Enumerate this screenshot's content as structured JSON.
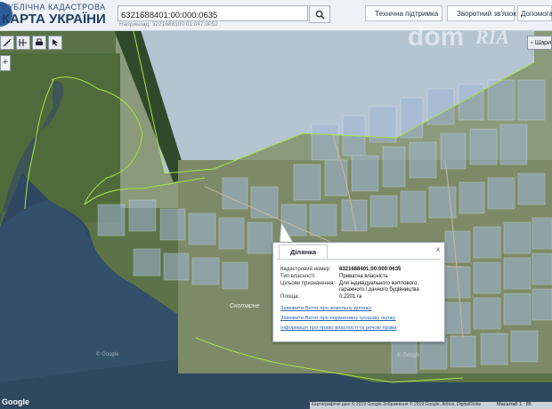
{
  "header": {
    "brand_line1": "ПУБЛІЧНА КАДАСТРОВА",
    "brand_line2": "КАРТА УКРАЇНИ",
    "search_value": "6321688401:00:000:0635",
    "search_hint": "Наприклад: 3221688100:01:047:0052",
    "support_label": "Технічна підтримка",
    "feedback_label": "Зворотний зв'язок",
    "help_label": "Допомога"
  },
  "map": {
    "layers_label": "Шари",
    "zoom_in_label": "+",
    "place_label": "Скотарне",
    "faint_label_left": "© Google",
    "faint_label_right": "© Google",
    "google_logo": "Google",
    "attribution": "Картографічні дані © 2019 Google Зображення © 2019 Google, Airbus, DigitalGlobe",
    "scale_label": "Масштаб 1 : 85"
  },
  "watermark": {
    "dom": "dom",
    "ria": "RIA"
  },
  "popup": {
    "tab_label": "Ділянка",
    "close_label": "x",
    "rows": [
      {
        "label": "Кадастровий номер:",
        "value": "6321688401:00:000:0635",
        "bold": true
      },
      {
        "label": "Тип власності:",
        "value": "Приватна власність"
      },
      {
        "label": "Цільове призначення:",
        "value": "Для індивідуального житлового,"
      },
      {
        "label": "",
        "value": "гаражного і дачного будівництва"
      },
      {
        "label": "Площа:",
        "value": "0.2201 га"
      }
    ],
    "links": [
      "Замовити Витяг про земельну ділянку",
      "Замовити Витяг про нормативну грошову оцінку",
      "Інформація про право власності та речові права"
    ]
  },
  "colors": {
    "header_bg": "#eef1f5",
    "link": "#2a63b5",
    "water": "#2f4760",
    "parcel_fill": "#9fb6d8",
    "boundary_green": "#a6e34a"
  }
}
